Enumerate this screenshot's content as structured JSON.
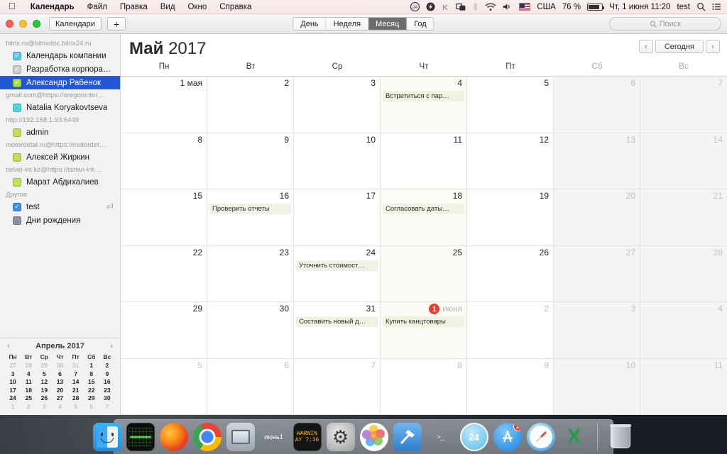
{
  "menubar": {
    "apple_icon": "apple-icon",
    "items": [
      {
        "label": "Календарь",
        "bold": true
      },
      {
        "label": "Файл",
        "bold": false
      },
      {
        "label": "Правка",
        "bold": false
      },
      {
        "label": "Вид",
        "bold": false
      },
      {
        "label": "Окно",
        "bold": false
      },
      {
        "label": "Справка",
        "bold": false
      }
    ],
    "status": {
      "language": "США",
      "battery_percent": "76 %",
      "datetime": "Чт, 1 июня  11:20",
      "user": "test",
      "icons": [
        "24-cloud-icon",
        "flash-icon",
        "k-icon",
        "screens-icon",
        "bluetooth-icon",
        "wifi-icon",
        "volume-icon",
        "flag-icon",
        "battery-icon",
        "search-icon",
        "notifications-icon"
      ]
    }
  },
  "toolbar": {
    "calendars_label": "Календари",
    "add_label": "+",
    "views": [
      {
        "label": "День",
        "active": false
      },
      {
        "label": "Неделя",
        "active": false
      },
      {
        "label": "Месяц",
        "active": true
      },
      {
        "label": "Год",
        "active": false
      }
    ],
    "search_placeholder": "Поиск",
    "search_value": ""
  },
  "sidebar": {
    "groups": [
      {
        "title": "bitrix.ru@bitrixdoc.bitrix24.ru",
        "items": [
          {
            "label": "Календарь компании",
            "checked": true,
            "color": "#5ac8e8",
            "selected": false,
            "shared": false
          },
          {
            "label": "Разработка корпора…",
            "checked": true,
            "color": "#cfcfcf",
            "selected": false,
            "shared": false
          },
          {
            "label": "Александр Рабенок",
            "checked": true,
            "color": "#a8de4a",
            "selected": true,
            "shared": false
          }
        ]
      },
      {
        "title": "gmail.com@https://oregoninter…",
        "items": [
          {
            "label": "Natalia Koryakovtseva",
            "checked": false,
            "color": "#4fd8d8",
            "selected": false,
            "shared": false
          }
        ]
      },
      {
        "title": "http://192.168.1.93:6449",
        "items": [
          {
            "label": "admin",
            "checked": false,
            "color": "#c2e05a",
            "selected": false,
            "shared": false
          }
        ]
      },
      {
        "title": "motordetal.ru@https://motordet…",
        "items": [
          {
            "label": "Алексей Жиркин",
            "checked": false,
            "color": "#c2e05a",
            "selected": false,
            "shared": false
          }
        ]
      },
      {
        "title": "tarlan-int.kz@https://tarlan-int.…",
        "items": [
          {
            "label": "Марат Абдихалиев",
            "checked": false,
            "color": "#c2e05a",
            "selected": false,
            "shared": false
          }
        ]
      },
      {
        "title": "Другое",
        "items": [
          {
            "label": "test",
            "checked": true,
            "color": "#3b90e8",
            "selected": false,
            "shared": true,
            "share_icon": "share-waves-icon"
          },
          {
            "label": "Дни рождения",
            "checked": false,
            "color": "#8894a3",
            "selected": false,
            "shared": false
          }
        ]
      }
    ],
    "mini_calendar": {
      "title": "Апрель 2017",
      "prev_icon": "chevron-left-icon",
      "next_icon": "chevron-right-icon",
      "dow": [
        "Пн",
        "Вт",
        "Ср",
        "Чт",
        "Пт",
        "Сб",
        "Вс"
      ],
      "weeks": [
        [
          {
            "d": "27",
            "dim": true
          },
          {
            "d": "28",
            "dim": true
          },
          {
            "d": "29",
            "dim": true
          },
          {
            "d": "30",
            "dim": true
          },
          {
            "d": "31",
            "dim": true
          },
          {
            "d": "1",
            "dim": false
          },
          {
            "d": "2",
            "dim": false
          }
        ],
        [
          {
            "d": "3",
            "dim": false
          },
          {
            "d": "4",
            "dim": false
          },
          {
            "d": "5",
            "dim": false
          },
          {
            "d": "6",
            "dim": false
          },
          {
            "d": "7",
            "dim": false
          },
          {
            "d": "8",
            "dim": false
          },
          {
            "d": "9",
            "dim": false
          }
        ],
        [
          {
            "d": "10",
            "dim": false
          },
          {
            "d": "11",
            "dim": false
          },
          {
            "d": "12",
            "dim": false
          },
          {
            "d": "13",
            "dim": false
          },
          {
            "d": "14",
            "dim": false
          },
          {
            "d": "15",
            "dim": false
          },
          {
            "d": "16",
            "dim": false
          }
        ],
        [
          {
            "d": "17",
            "dim": false
          },
          {
            "d": "18",
            "dim": false
          },
          {
            "d": "19",
            "dim": false
          },
          {
            "d": "20",
            "dim": false
          },
          {
            "d": "21",
            "dim": false
          },
          {
            "d": "22",
            "dim": false
          },
          {
            "d": "23",
            "dim": false
          }
        ],
        [
          {
            "d": "24",
            "dim": false
          },
          {
            "d": "25",
            "dim": false
          },
          {
            "d": "26",
            "dim": false
          },
          {
            "d": "27",
            "dim": false
          },
          {
            "d": "28",
            "dim": false
          },
          {
            "d": "29",
            "dim": false
          },
          {
            "d": "30",
            "dim": false
          }
        ],
        [
          {
            "d": "1",
            "dim": true
          },
          {
            "d": "2",
            "dim": true
          },
          {
            "d": "3",
            "dim": true
          },
          {
            "d": "4",
            "dim": true
          },
          {
            "d": "5",
            "dim": true
          },
          {
            "d": "6",
            "dim": true
          },
          {
            "d": "7",
            "dim": true
          }
        ]
      ]
    }
  },
  "calendar": {
    "month": "Май",
    "year": "2017",
    "prev_icon": "chevron-left-icon",
    "next_icon": "chevron-right-icon",
    "today_label": "Сегодня",
    "dow": [
      {
        "label": "Пн",
        "weekend": false
      },
      {
        "label": "Вт",
        "weekend": false
      },
      {
        "label": "Ср",
        "weekend": false
      },
      {
        "label": "Чт",
        "weekend": false
      },
      {
        "label": "Пт",
        "weekend": false
      },
      {
        "label": "Сб",
        "weekend": true
      },
      {
        "label": "Вс",
        "weekend": true
      }
    ],
    "weeks": [
      [
        {
          "day": "1 мая",
          "dim": false,
          "weekend": false,
          "events": []
        },
        {
          "day": "2",
          "dim": false,
          "weekend": false,
          "events": []
        },
        {
          "day": "3",
          "dim": false,
          "weekend": false,
          "events": []
        },
        {
          "day": "4",
          "dim": false,
          "weekend": false,
          "tint": true,
          "events": [
            {
              "title": "Встретиться с пар…",
              "color": "#f0f3e2"
            }
          ]
        },
        {
          "day": "5",
          "dim": false,
          "weekend": false,
          "events": []
        },
        {
          "day": "6",
          "dim": true,
          "weekend": true,
          "events": []
        },
        {
          "day": "7",
          "dim": true,
          "weekend": true,
          "events": []
        }
      ],
      [
        {
          "day": "8",
          "dim": false,
          "weekend": false,
          "events": []
        },
        {
          "day": "9",
          "dim": false,
          "weekend": false,
          "events": []
        },
        {
          "day": "10",
          "dim": false,
          "weekend": false,
          "events": []
        },
        {
          "day": "11",
          "dim": false,
          "weekend": false,
          "events": []
        },
        {
          "day": "12",
          "dim": false,
          "weekend": false,
          "events": []
        },
        {
          "day": "13",
          "dim": true,
          "weekend": true,
          "events": []
        },
        {
          "day": "14",
          "dim": true,
          "weekend": true,
          "events": []
        }
      ],
      [
        {
          "day": "15",
          "dim": false,
          "weekend": false,
          "events": []
        },
        {
          "day": "16",
          "dim": false,
          "weekend": false,
          "events": [
            {
              "title": "Проверить отчеты",
              "color": "#f0f3e2"
            }
          ]
        },
        {
          "day": "17",
          "dim": false,
          "weekend": false,
          "events": []
        },
        {
          "day": "18",
          "dim": false,
          "weekend": false,
          "tint": true,
          "events": [
            {
              "title": "Согласовать даты…",
              "color": "#f0f3e2"
            }
          ]
        },
        {
          "day": "19",
          "dim": false,
          "weekend": false,
          "events": []
        },
        {
          "day": "20",
          "dim": true,
          "weekend": true,
          "events": []
        },
        {
          "day": "21",
          "dim": true,
          "weekend": true,
          "events": []
        }
      ],
      [
        {
          "day": "22",
          "dim": false,
          "weekend": false,
          "events": []
        },
        {
          "day": "23",
          "dim": false,
          "weekend": false,
          "events": []
        },
        {
          "day": "24",
          "dim": false,
          "weekend": false,
          "events": [
            {
              "title": "Уточнить стоимост…",
              "color": "#f0f3e2"
            }
          ]
        },
        {
          "day": "25",
          "dim": false,
          "weekend": false,
          "tint": true,
          "events": []
        },
        {
          "day": "26",
          "dim": false,
          "weekend": false,
          "events": []
        },
        {
          "day": "27",
          "dim": true,
          "weekend": true,
          "events": []
        },
        {
          "day": "28",
          "dim": true,
          "weekend": true,
          "events": []
        }
      ],
      [
        {
          "day": "29",
          "dim": false,
          "weekend": false,
          "events": []
        },
        {
          "day": "30",
          "dim": false,
          "weekend": false,
          "events": []
        },
        {
          "day": "31",
          "dim": false,
          "weekend": false,
          "events": [
            {
              "title": "Составить новый д…",
              "color": "#f0f3e2"
            }
          ]
        },
        {
          "day": "1",
          "dim": false,
          "weekend": false,
          "today": true,
          "today_suffix": "июня",
          "tint": true,
          "events": [
            {
              "title": "Купить канцтовары",
              "color": "#f0f3e2"
            }
          ]
        },
        {
          "day": "2",
          "dim": true,
          "weekend": false,
          "events": []
        },
        {
          "day": "3",
          "dim": true,
          "weekend": true,
          "events": []
        },
        {
          "day": "4",
          "dim": true,
          "weekend": true,
          "events": []
        }
      ],
      [
        {
          "day": "5",
          "dim": true,
          "weekend": false,
          "events": []
        },
        {
          "day": "6",
          "dim": true,
          "weekend": false,
          "events": []
        },
        {
          "day": "7",
          "dim": true,
          "weekend": false,
          "events": []
        },
        {
          "day": "8",
          "dim": true,
          "weekend": false,
          "events": []
        },
        {
          "day": "9",
          "dim": true,
          "weekend": false,
          "events": []
        },
        {
          "day": "10",
          "dim": true,
          "weekend": true,
          "events": []
        },
        {
          "day": "11",
          "dim": true,
          "weekend": true,
          "events": []
        }
      ]
    ]
  },
  "dock": {
    "items": [
      {
        "name": "finder",
        "kind": "finder",
        "running": true
      },
      {
        "name": "activity-monitor",
        "kind": "activity",
        "running": true
      },
      {
        "name": "firefox",
        "kind": "firefox",
        "running": true
      },
      {
        "name": "google-chrome",
        "kind": "chrome",
        "running": true
      },
      {
        "name": "remote-desktop",
        "kind": "rdp",
        "running": false
      },
      {
        "name": "calendar",
        "kind": "calendar",
        "month": "июнь",
        "day": "1",
        "running": true
      },
      {
        "name": "warning-clock",
        "kind": "warn",
        "line1": "WARNIN",
        "line2": "AY 7:36",
        "running": false
      },
      {
        "name": "system-preferences",
        "kind": "sysprefs",
        "running": false
      },
      {
        "name": "photos",
        "kind": "photos",
        "running": false
      },
      {
        "name": "xcode",
        "kind": "xcode",
        "running": false
      },
      {
        "name": "terminal",
        "kind": "terminal",
        "running": false
      },
      {
        "name": "cloud-24",
        "kind": "cloud24",
        "label": "24",
        "running": true
      },
      {
        "name": "app-store",
        "kind": "appstore",
        "badge": "2",
        "running": true
      },
      {
        "name": "safari",
        "kind": "safari",
        "running": true
      },
      {
        "name": "excel",
        "kind": "excel",
        "label": "X",
        "running": true
      },
      {
        "name": "separator",
        "kind": "separator"
      },
      {
        "name": "trash",
        "kind": "trash",
        "running": false
      }
    ]
  }
}
